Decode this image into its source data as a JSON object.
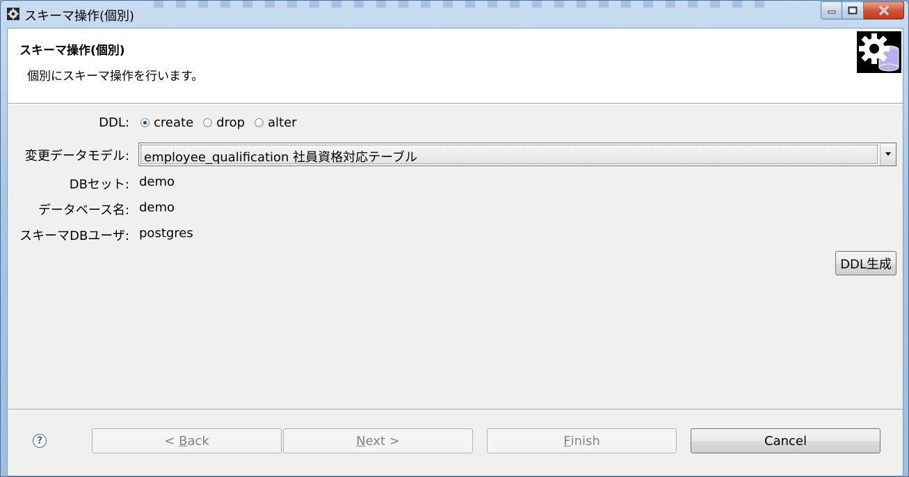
{
  "window": {
    "title": "スキーマ操作(個別)"
  },
  "header": {
    "title": "スキーマ操作(個別)",
    "description": "個別にスキーマ操作を行います。"
  },
  "form": {
    "ddl_label": "DDL:",
    "ddl_options": [
      {
        "label": "create",
        "selected": true
      },
      {
        "label": "drop",
        "selected": false
      },
      {
        "label": "alter",
        "selected": false
      }
    ],
    "model_label": "変更データモデル:",
    "model_value": "employee_qualification 社員資格対応テーブル",
    "dbset_label": "DBセット:",
    "dbset_value": "demo",
    "dbname_label": "データベース名:",
    "dbname_value": "demo",
    "dbuser_label": "スキーマDBユーザ:",
    "dbuser_value": "postgres",
    "generate_button": "DDL生成"
  },
  "footer": {
    "back_prefix": "< ",
    "back_mnemonic": "B",
    "back_rest": "ack",
    "next_mnemonic": "N",
    "next_rest": "ext >",
    "finish_mnemonic": "F",
    "finish_rest": "inish",
    "cancel": "Cancel"
  },
  "colors": {
    "selected_radio": "#1d4a7a",
    "help_icon": "#3a6ea5"
  }
}
